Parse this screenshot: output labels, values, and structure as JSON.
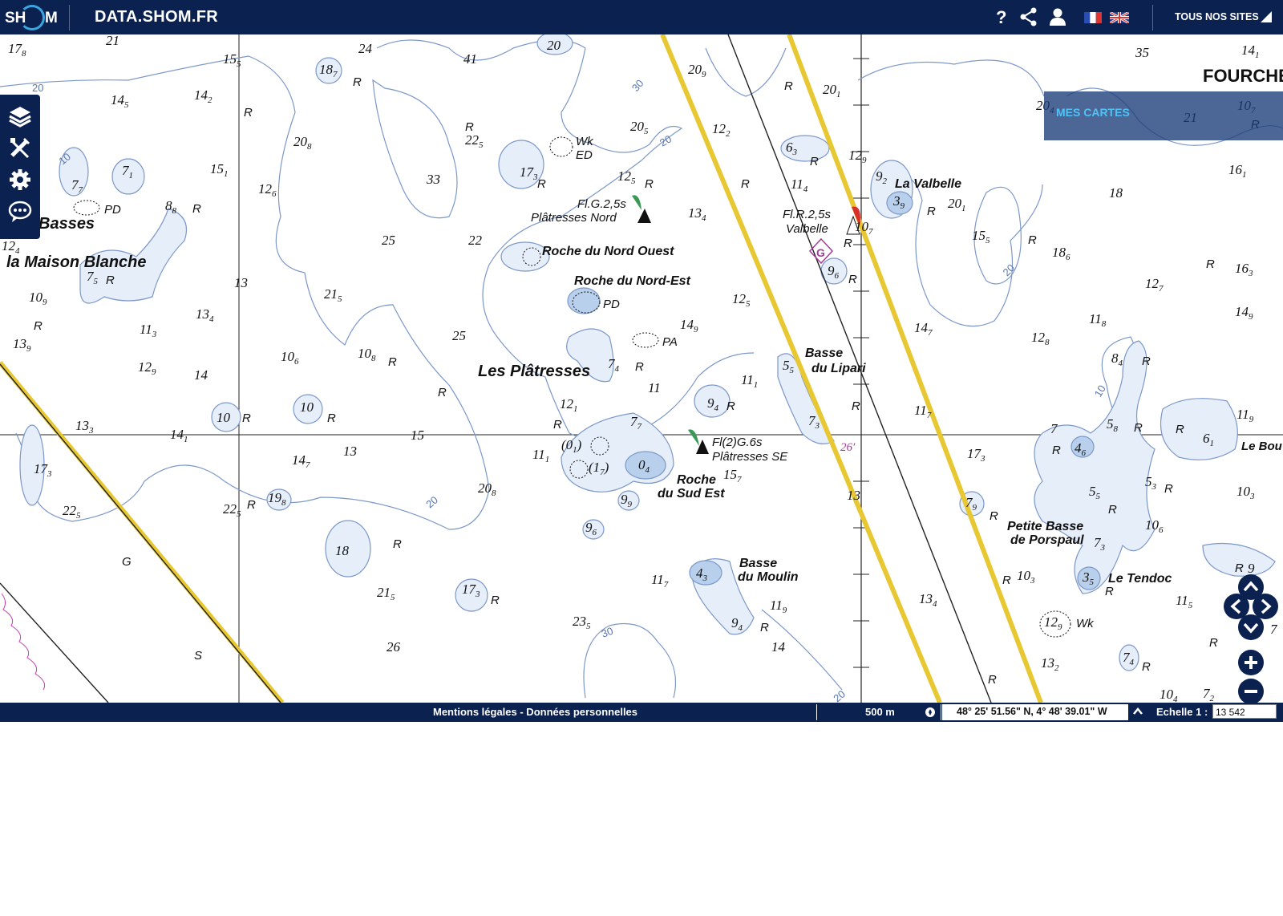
{
  "header": {
    "site_title": "DATA.SHOM.FR",
    "logo_text_left": "SH",
    "logo_text_right": "M",
    "sites_label": "TOUS NOS SITES",
    "icons": [
      "help-icon",
      "share-icon",
      "user-icon",
      "flag-fr-icon",
      "flag-uk-icon",
      "chevron-up-icon"
    ]
  },
  "toolbar": {
    "items": [
      "layers-icon",
      "tools-icon",
      "settings-icon",
      "chat-icon"
    ]
  },
  "panel": {
    "mes_cartes_label": "MES CARTES"
  },
  "map": {
    "place_names": {
      "basses": "Basses",
      "maison_blanche": "la Maison Blanche",
      "les_platresses": "Les Plâtresses",
      "roche_nord_ouest": "Roche du Nord Ouest",
      "roche_nord_est": "Roche du Nord-Est",
      "la_valbelle": "La Valbelle",
      "basse_lipari_1": "Basse",
      "basse_lipari_2": "du Lipari",
      "roche_sud_est_1": "Roche",
      "roche_sud_est_2": "du Sud Est",
      "basse_moulin_1": "Basse",
      "basse_moulin_2": "du Moulin",
      "petite_basse_1": "Petite Basse",
      "petite_basse_2": "de Porspaul",
      "le_tendoc": "Le Tendoc",
      "fourche": "FOURCHE",
      "le_bou": "Le Bou"
    },
    "light_labels": {
      "platresses_nord_light": "Fl.G.2,5s",
      "platresses_nord_name": "Plâtresses Nord",
      "valbelle_light": "Fl.R.2,5s",
      "valbelle_name": "Valbelle",
      "platresses_se_light": "Fl(2)G.6s",
      "platresses_se_name": "Plâtresses SE"
    },
    "annotations": {
      "wk_1": "Wk",
      "ed": "ED",
      "pd_1": "PD",
      "pd_2": "PD",
      "pa": "PA",
      "wk_2": "Wk",
      "minute_mark": "26′"
    }
  },
  "footer": {
    "legal_text": "Mentions légales - Données personnelles",
    "scale_bar_label": "500 m",
    "coordinates": "48° 25' 51.56\" N, 4° 48' 39.01\" W",
    "scale_label": "Echelle 1 :",
    "scale_value": "13 542"
  },
  "colors": {
    "header_bg": "#0b2150",
    "fairway_yellow": "#e8c832",
    "contour_blue": "#7c98c8",
    "shoal_fill": "#e6eefa",
    "green_light": "#3a9a55",
    "red_light": "#d9302b",
    "magenta": "#a43a9a"
  }
}
